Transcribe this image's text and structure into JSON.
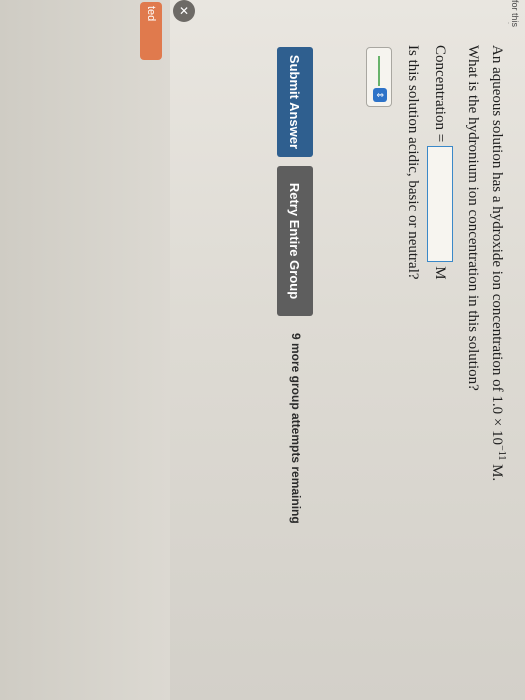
{
  "side_tab": {
    "label": "ted"
  },
  "question": {
    "line1": "An aqueous solution has a hydroxide ion concentration of 1.0 × 10",
    "line1_exponent": "−11",
    "line1_end": " M.",
    "line2": "What is the hydronium ion concentration in this solution?",
    "concentration_label": "Concentration =",
    "concentration_unit": "M",
    "concentration_value": "",
    "line3": "Is this solution acidic, basic or neutral?"
  },
  "buttons": {
    "submit": "Submit Answer",
    "retry": "Retry Entire Group"
  },
  "attempts_text": "9 more group attempts remaining",
  "corner_hint": "for this question"
}
